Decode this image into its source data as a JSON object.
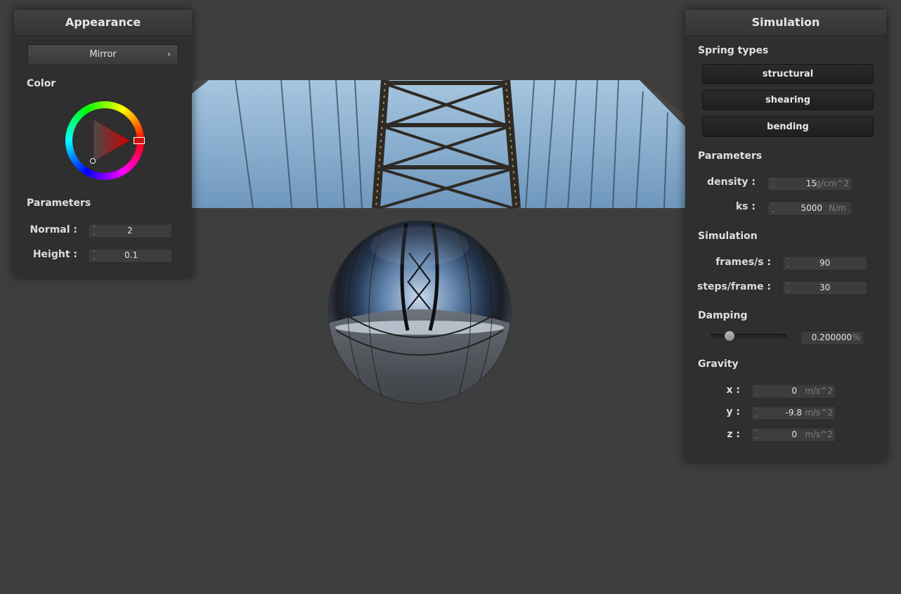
{
  "appearance": {
    "title": "Appearance",
    "shader_selector": "Mirror",
    "color_heading": "Color",
    "parameters_heading": "Parameters",
    "normal_label": "Normal :",
    "normal_value": "2",
    "height_label": "Height :",
    "height_value": "0.1",
    "color_selected": "#cc0000"
  },
  "simulation": {
    "title": "Simulation",
    "spring_types_heading": "Spring types",
    "spring_buttons": [
      "structural",
      "shearing",
      "bending"
    ],
    "parameters_heading": "Parameters",
    "density_label": "density :",
    "density_value": "15",
    "density_unit": "g/cm^2",
    "ks_label": "ks :",
    "ks_value": "5000",
    "ks_unit": "N/m",
    "sim_heading": "Simulation",
    "fps_label": "frames/s :",
    "fps_value": "90",
    "steps_label": "steps/frame :",
    "steps_value": "30",
    "damping_heading": "Damping",
    "damping_value": "0.200000",
    "damping_unit": "%",
    "damping_slider_fraction": 0.2,
    "gravity_heading": "Gravity",
    "gx_label": "x :",
    "gx_value": "0",
    "gy_label": "y :",
    "gy_value": "-9.8",
    "gz_label": "z :",
    "gz_value": "0",
    "gravity_unit": "m/s^2"
  },
  "viewport": {
    "background": "#3e3e3e",
    "sky_color": "#8fb4d4",
    "object": "mirror-sphere"
  }
}
